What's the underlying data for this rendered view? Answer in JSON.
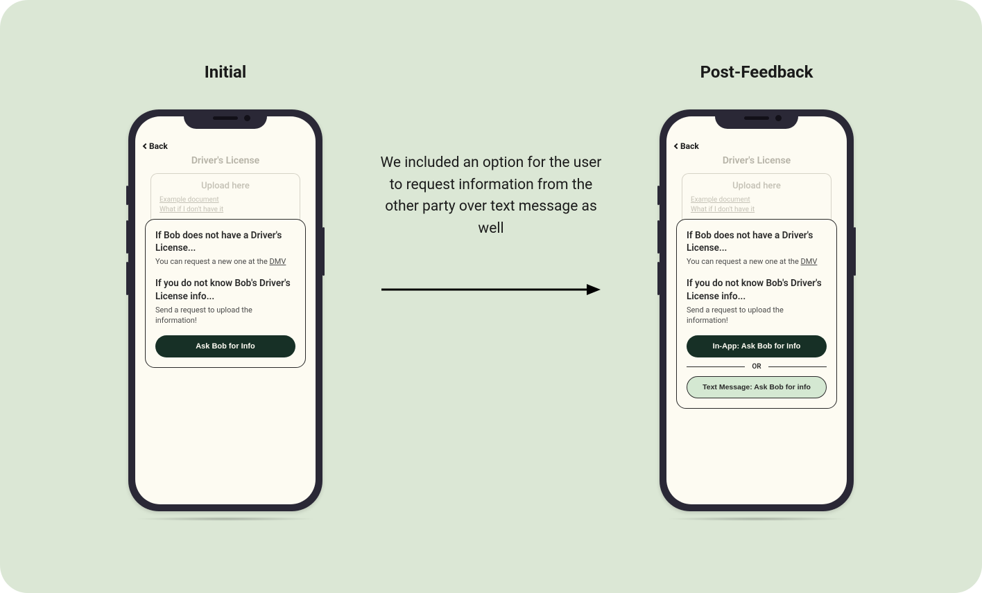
{
  "columns": {
    "left_title": "Initial",
    "right_title": "Post-Feedback"
  },
  "center_text": "We included an option for the user to request information from the other party over text message as well",
  "screen": {
    "back_label": "Back",
    "page_title": "Driver's License",
    "upload": {
      "title": "Upload here",
      "example_link": "Example document",
      "missing_link": "What if I don't have it"
    },
    "modal": {
      "heading1": "If Bob does not have a Driver's License...",
      "body1_prefix": "You can request a new one at the ",
      "body1_link": "DMV",
      "heading2": "If you do not know Bob's Driver's License info...",
      "body2": "Send a request to upload the information!",
      "ask_button": "Ask Bob for Info",
      "in_app_button": "In-App: Ask Bob for Info",
      "or_label": "OR",
      "text_msg_button": "Text Message: Ask Bob for info"
    }
  }
}
